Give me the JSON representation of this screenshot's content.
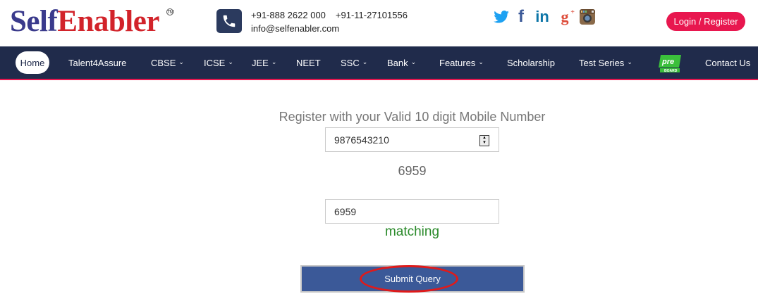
{
  "brand": {
    "part1": "Self",
    "part2": "Enabler",
    "tm": "TM"
  },
  "contact": {
    "phone1": "+91-888 2622 000",
    "phone2": "+91-11-27101556",
    "email": "info@selfenabler.com"
  },
  "social": {
    "icons": [
      "twitter-icon",
      "facebook-icon",
      "linkedin-icon",
      "google-plus-icon",
      "instagram-icon"
    ],
    "facebook_glyph": "f",
    "linkedin_glyph": "in",
    "googleplus_glyph": "g",
    "googleplus_sup": "+"
  },
  "login": {
    "label": "Login / Register"
  },
  "nav": {
    "home": "Home",
    "items": [
      {
        "label": "Talent4Assure",
        "dropdown": false
      },
      {
        "label": "CBSE",
        "dropdown": true
      },
      {
        "label": "ICSE",
        "dropdown": true
      },
      {
        "label": "JEE",
        "dropdown": true
      },
      {
        "label": "NEET",
        "dropdown": false
      },
      {
        "label": "SSC",
        "dropdown": true
      },
      {
        "label": "Bank",
        "dropdown": true
      },
      {
        "label": "Features",
        "dropdown": true
      },
      {
        "label": "Scholarship",
        "dropdown": false
      },
      {
        "label": "Test Series",
        "dropdown": true
      },
      {
        "label": "Contact Us",
        "dropdown": false
      }
    ],
    "preboard": {
      "top": "pre",
      "bottom": "BOARD"
    }
  },
  "form": {
    "title": "Register with your Valid 10 digit Mobile Number",
    "mobile_value": "9876543210",
    "captcha_text": "6959",
    "captcha_input_value": "6959",
    "match_status": "matching",
    "submit_label": "Submit Query"
  },
  "colors": {
    "nav_bg": "#202b4b",
    "accent": "#e8174f",
    "submit_bg": "#3b5998",
    "match_green": "#2a8a2a",
    "annotation_red": "#e01a1a"
  }
}
